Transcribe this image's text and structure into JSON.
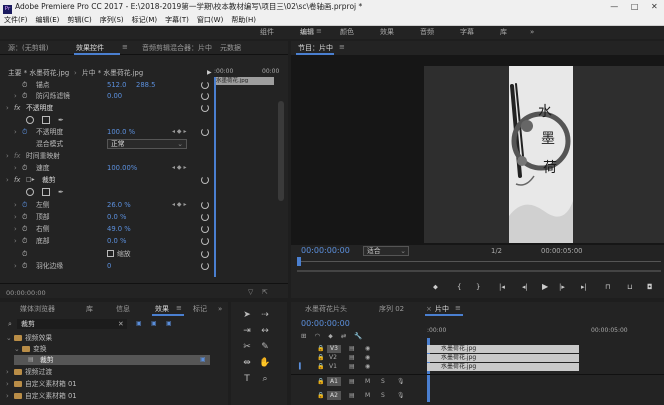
{
  "app": {
    "title": "Adobe Premiere Pro CC 2017 - E:\\2018-2019第一学期\\校本教材编写\\项目三\\02\\sc\\卷轴画.prproj *",
    "window_controls": [
      "—",
      "□",
      "✕"
    ]
  },
  "menu": [
    "文件(F)",
    "编辑(E)",
    "剪辑(C)",
    "序列(S)",
    "标记(M)",
    "字幕(T)",
    "窗口(W)",
    "帮助(H)"
  ],
  "workspaces": [
    "组件",
    "编辑",
    "颜色",
    "效果",
    "音频",
    "字幕",
    "库"
  ],
  "workspace_more": "»",
  "source_panel": {
    "tabs": [
      "源：(无剪辑)",
      "效果控件",
      "音频剪辑混合器：片中",
      "元数据"
    ],
    "menu_icon": "≡",
    "master": "主要 * 水墨荷花.jpg",
    "clip": "片中 * 水墨荷花.jpg",
    "ruler_start": ":00:00",
    "ruler_end": "00:00",
    "clip_label": "水墨荷花.jpg",
    "anchor": {
      "label": "锚点",
      "x": "512.0",
      "y": "288.5"
    },
    "anti_flicker": {
      "label": "防闪烁滤镜",
      "value": "0.00"
    },
    "opacity": {
      "fx": "fx",
      "label": "不透明度"
    },
    "opacity_value": {
      "label": "不透明度",
      "value": "100.0 %"
    },
    "blend": {
      "label": "混合模式",
      "value": "正常"
    },
    "time_remap": {
      "fx": "fx",
      "label": "时间重映射"
    },
    "speed": {
      "label": "速度",
      "value": "100.00%"
    },
    "crop": {
      "fx": "fx",
      "label": "裁剪"
    },
    "left": {
      "label": "左侧",
      "value": "26.0 %"
    },
    "top": {
      "label": "顶部",
      "value": "0.0 %"
    },
    "right": {
      "label": "右侧",
      "value": "49.0 %"
    },
    "bottom": {
      "label": "底部",
      "value": "0.0 %"
    },
    "zoom": {
      "label": "缩放"
    },
    "feather": {
      "label": "羽化边缘",
      "value": "0"
    },
    "timecode": "00:00:00:00"
  },
  "program_panel": {
    "tab": "节目：片中",
    "menu_icon": "≡",
    "timecode": "00:00:00:00",
    "fit": "适合",
    "ratio": "1/2",
    "duration": "00:00:05:00",
    "image_text": "水墨荷"
  },
  "effects_panel": {
    "tabs": [
      "媒体浏览器",
      "库",
      "信息",
      "效果",
      "标记"
    ],
    "more": "»",
    "search_value": "裁剪",
    "tree": [
      {
        "label": "视频效果",
        "level": 0
      },
      {
        "label": "变换",
        "level": 1
      },
      {
        "label": "裁剪",
        "level": 2,
        "selected": true
      },
      {
        "label": "视频过渡",
        "level": 0
      },
      {
        "label": "自定义素材箱 01",
        "level": 0
      },
      {
        "label": "自定义素材箱 01",
        "level": 0
      }
    ]
  },
  "timeline": {
    "tabs": [
      "水墨荷花片头",
      "序列 02",
      "片中"
    ],
    "timecode": "00:00:00:00",
    "ruler_start": ":00:00",
    "ruler_mid": "00:00:05:00",
    "tracks_video": [
      "V3",
      "V2",
      "V1"
    ],
    "tracks_audio": [
      "A1",
      "A2"
    ],
    "audio_btns": [
      "M",
      "S"
    ],
    "clips": [
      "水墨荷花.jpg",
      "水墨荷花.jpg",
      "水墨荷花.jpg"
    ]
  },
  "colors": {
    "accent": "#4a7fd0",
    "value_blue": "#5b8fdc",
    "clip": "#c9c9c9",
    "folder": "#b98d47"
  }
}
